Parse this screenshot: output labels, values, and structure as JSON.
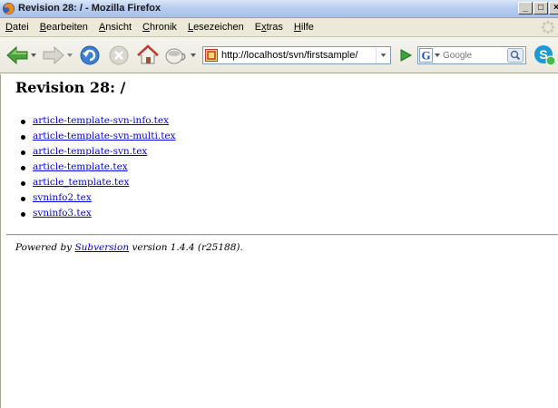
{
  "window": {
    "title": "Revision 28: / - Mozilla Firefox",
    "controls": [
      "_",
      "□",
      "×"
    ]
  },
  "menu": {
    "items": [
      {
        "accel": "D",
        "rest": "atei"
      },
      {
        "accel": "B",
        "rest": "earbeiten"
      },
      {
        "accel": "A",
        "rest": "nsicht"
      },
      {
        "accel": "C",
        "rest": "hronik"
      },
      {
        "accel": "L",
        "rest": "esezeichen"
      },
      {
        "pre": "E",
        "accel": "x",
        "rest": "tras"
      },
      {
        "accel": "H",
        "rest": "ilfe"
      }
    ]
  },
  "toolbar": {
    "icons": [
      "back-icon",
      "forward-icon",
      "reload-icon",
      "stop-icon",
      "home-icon",
      "bookmark-cup-icon"
    ],
    "url": "http://localhost/svn/firstsample/",
    "search_placeholder": "Google",
    "accent": "#2f8f2f"
  },
  "page": {
    "title": "Revision 28: /",
    "files": [
      "article-template-svn-info.tex",
      "article-template-svn-multi.tex",
      "article-template-svn.tex",
      "article-template.tex",
      "article_template.tex",
      "svninfo2.tex",
      "svninfo3.tex"
    ],
    "footer": {
      "prefix": "Powered by ",
      "link": "Subversion",
      "suffix": " version 1.4.4 (r25188)."
    },
    "link_color": "#0000ee"
  }
}
